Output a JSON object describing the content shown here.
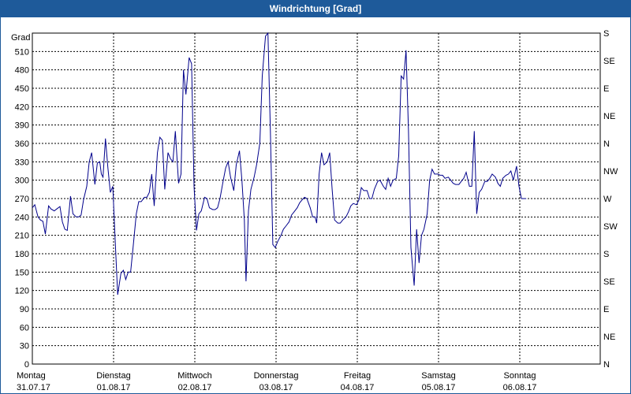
{
  "window": {
    "title": "Windrichtung [Grad]"
  },
  "colors": {
    "title_bg": "#1e5a9a",
    "series": "#00008b",
    "grid": "#000000"
  },
  "chart_data": {
    "type": "line",
    "title": "Windrichtung [Grad]",
    "ylabel": "Grad",
    "ylim": [
      0,
      540
    ],
    "y_ticks": [
      0,
      30,
      60,
      90,
      120,
      150,
      180,
      210,
      240,
      270,
      300,
      330,
      360,
      390,
      420,
      450,
      480,
      510
    ],
    "y_right_ticks": [
      "N",
      "NE",
      "E",
      "SE",
      "S",
      "SW",
      "W",
      "NW",
      "N",
      "NE",
      "E",
      "SE",
      "S"
    ],
    "y_right_values": [
      0,
      45,
      90,
      135,
      180,
      225,
      270,
      315,
      360,
      405,
      450,
      495,
      540
    ],
    "xlim": [
      0,
      7
    ],
    "x_ticks": [
      {
        "x": 0,
        "day": "Montag",
        "date": "31.07.17"
      },
      {
        "x": 1,
        "day": "Dienstag",
        "date": "01.08.17"
      },
      {
        "x": 2,
        "day": "Mittwoch",
        "date": "02.08.17"
      },
      {
        "x": 3,
        "day": "Donnerstag",
        "date": "03.08.17"
      },
      {
        "x": 4,
        "day": "Freitag",
        "date": "04.08.17"
      },
      {
        "x": 5,
        "day": "Samstag",
        "date": "05.08.17"
      },
      {
        "x": 6,
        "day": "Sonntag",
        "date": "06.08.17"
      }
    ],
    "grid": true,
    "series": [
      {
        "values": [
          [
            0.0,
            255
          ],
          [
            0.03,
            260
          ],
          [
            0.07,
            240
          ],
          [
            0.1,
            235
          ],
          [
            0.13,
            233
          ],
          [
            0.16,
            212
          ],
          [
            0.2,
            258
          ],
          [
            0.23,
            253
          ],
          [
            0.27,
            250
          ],
          [
            0.3,
            253
          ],
          [
            0.34,
            257
          ],
          [
            0.37,
            232
          ],
          [
            0.4,
            220
          ],
          [
            0.43,
            218
          ],
          [
            0.47,
            274
          ],
          [
            0.5,
            245
          ],
          [
            0.54,
            240
          ],
          [
            0.57,
            240
          ],
          [
            0.6,
            243
          ],
          [
            0.63,
            268
          ],
          [
            0.67,
            290
          ],
          [
            0.7,
            330
          ],
          [
            0.73,
            345
          ],
          [
            0.77,
            293
          ],
          [
            0.8,
            328
          ],
          [
            0.83,
            330
          ],
          [
            0.85,
            310
          ],
          [
            0.87,
            305
          ],
          [
            0.9,
            368
          ],
          [
            0.93,
            320
          ],
          [
            0.96,
            280
          ],
          [
            0.99,
            290
          ],
          [
            1.02,
            200
          ],
          [
            1.05,
            113
          ],
          [
            1.09,
            148
          ],
          [
            1.12,
            153
          ],
          [
            1.15,
            138
          ],
          [
            1.18,
            150
          ],
          [
            1.21,
            150
          ],
          [
            1.24,
            190
          ],
          [
            1.28,
            245
          ],
          [
            1.31,
            265
          ],
          [
            1.34,
            265
          ],
          [
            1.38,
            272
          ],
          [
            1.41,
            272
          ],
          [
            1.44,
            280
          ],
          [
            1.47,
            310
          ],
          [
            1.5,
            258
          ],
          [
            1.54,
            345
          ],
          [
            1.57,
            370
          ],
          [
            1.6,
            365
          ],
          [
            1.63,
            285
          ],
          [
            1.67,
            345
          ],
          [
            1.7,
            335
          ],
          [
            1.73,
            330
          ],
          [
            1.76,
            380
          ],
          [
            1.8,
            295
          ],
          [
            1.83,
            310
          ],
          [
            1.86,
            480
          ],
          [
            1.89,
            440
          ],
          [
            1.93,
            500
          ],
          [
            1.96,
            490
          ],
          [
            1.99,
            290
          ],
          [
            2.02,
            218
          ],
          [
            2.05,
            245
          ],
          [
            2.08,
            250
          ],
          [
            2.12,
            272
          ],
          [
            2.15,
            270
          ],
          [
            2.18,
            255
          ],
          [
            2.22,
            252
          ],
          [
            2.25,
            252
          ],
          [
            2.28,
            255
          ],
          [
            2.31,
            270
          ],
          [
            2.35,
            300
          ],
          [
            2.38,
            320
          ],
          [
            2.41,
            330
          ],
          [
            2.44,
            305
          ],
          [
            2.48,
            283
          ],
          [
            2.51,
            325
          ],
          [
            2.55,
            348
          ],
          [
            2.58,
            300
          ],
          [
            2.61,
            235
          ],
          [
            2.63,
            135
          ],
          [
            2.66,
            250
          ],
          [
            2.69,
            285
          ],
          [
            2.73,
            305
          ],
          [
            2.76,
            325
          ],
          [
            2.8,
            360
          ],
          [
            2.83,
            470
          ],
          [
            2.87,
            535
          ],
          [
            2.9,
            543
          ],
          [
            2.93,
            380
          ],
          [
            2.96,
            195
          ],
          [
            2.99,
            190
          ],
          [
            3.02,
            200
          ],
          [
            3.06,
            210
          ],
          [
            3.09,
            220
          ],
          [
            3.12,
            225
          ],
          [
            3.16,
            232
          ],
          [
            3.19,
            243
          ],
          [
            3.22,
            248
          ],
          [
            3.26,
            255
          ],
          [
            3.29,
            263
          ],
          [
            3.32,
            268
          ],
          [
            3.35,
            272
          ],
          [
            3.38,
            270
          ],
          [
            3.42,
            255
          ],
          [
            3.45,
            240
          ],
          [
            3.48,
            240
          ],
          [
            3.5,
            230
          ],
          [
            3.53,
            310
          ],
          [
            3.56,
            345
          ],
          [
            3.59,
            325
          ],
          [
            3.63,
            330
          ],
          [
            3.66,
            345
          ],
          [
            3.69,
            285
          ],
          [
            3.72,
            235
          ],
          [
            3.76,
            230
          ],
          [
            3.79,
            230
          ],
          [
            3.82,
            235
          ],
          [
            3.86,
            240
          ],
          [
            3.89,
            248
          ],
          [
            3.92,
            258
          ],
          [
            3.95,
            262
          ],
          [
            3.99,
            260
          ],
          [
            4.02,
            268
          ],
          [
            4.05,
            288
          ],
          [
            4.08,
            283
          ],
          [
            4.12,
            283
          ],
          [
            4.15,
            270
          ],
          [
            4.18,
            270
          ],
          [
            4.21,
            285
          ],
          [
            4.25,
            298
          ],
          [
            4.28,
            300
          ],
          [
            4.32,
            290
          ],
          [
            4.35,
            285
          ],
          [
            4.38,
            303
          ],
          [
            4.41,
            290
          ],
          [
            4.44,
            300
          ],
          [
            4.48,
            303
          ],
          [
            4.51,
            340
          ],
          [
            4.54,
            470
          ],
          [
            4.57,
            465
          ],
          [
            4.6,
            512
          ],
          [
            4.63,
            380
          ],
          [
            4.66,
            190
          ],
          [
            4.7,
            128
          ],
          [
            4.73,
            220
          ],
          [
            4.76,
            165
          ],
          [
            4.79,
            210
          ],
          [
            4.82,
            220
          ],
          [
            4.86,
            245
          ],
          [
            4.89,
            300
          ],
          [
            4.92,
            318
          ],
          [
            4.95,
            310
          ],
          [
            4.99,
            310
          ],
          [
            5.02,
            308
          ],
          [
            5.05,
            308
          ],
          [
            5.08,
            303
          ],
          [
            5.12,
            305
          ],
          [
            5.15,
            300
          ],
          [
            5.18,
            295
          ],
          [
            5.21,
            293
          ],
          [
            5.25,
            293
          ],
          [
            5.28,
            298
          ],
          [
            5.31,
            303
          ],
          [
            5.34,
            313
          ],
          [
            5.38,
            290
          ],
          [
            5.41,
            290
          ],
          [
            5.44,
            380
          ],
          [
            5.47,
            245
          ],
          [
            5.5,
            280
          ],
          [
            5.53,
            285
          ],
          [
            5.57,
            298
          ],
          [
            5.6,
            298
          ],
          [
            5.63,
            303
          ],
          [
            5.66,
            310
          ],
          [
            5.7,
            305
          ],
          [
            5.73,
            295
          ],
          [
            5.76,
            290
          ],
          [
            5.79,
            303
          ],
          [
            5.83,
            308
          ],
          [
            5.86,
            310
          ],
          [
            5.89,
            315
          ],
          [
            5.92,
            300
          ],
          [
            5.96,
            323
          ],
          [
            5.99,
            290
          ],
          [
            6.02,
            270
          ],
          [
            6.06,
            270
          ],
          [
            6.08,
            270
          ]
        ]
      }
    ]
  }
}
